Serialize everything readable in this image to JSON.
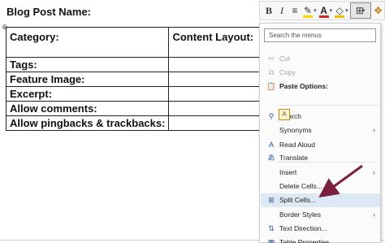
{
  "document": {
    "title": "Blog Post Name:",
    "table_rows": [
      [
        "Category:",
        "Content Layout:",
        ""
      ],
      [
        "Tags:",
        "",
        ""
      ],
      [
        "Feature Image:",
        "",
        ""
      ],
      [
        "Excerpt:",
        "",
        ""
      ],
      [
        "Allow comments:",
        "",
        ""
      ],
      [
        "Allow pingbacks & trackbacks:",
        "",
        ""
      ]
    ],
    "move_handle_glyph": "⊕"
  },
  "toolbar": {
    "bold_glyph": "B",
    "italic_glyph": "I",
    "underline_glyph": "≡",
    "highlight_glyph": "✎",
    "fontcolor_glyph": "A",
    "shading_glyph": "◇",
    "borders_glyph": "⊞",
    "drop_glyph": "▾",
    "paint_glyph": "✥",
    "icons": [
      "bold-icon",
      "italic-icon",
      "paragraph-icon",
      "highlight-icon",
      "font-color-icon",
      "shading-icon",
      "borders-icon",
      "format-painter-icon"
    ]
  },
  "context_menu": {
    "search_placeholder": "Search the menus",
    "items": [
      {
        "label": "Cut",
        "icon": "✂",
        "disabled": true
      },
      {
        "label": "Copy",
        "icon": "⧉",
        "disabled": true
      },
      {
        "label": "Paste Options:",
        "icon": "📋",
        "bold": true
      },
      {
        "label": "Search",
        "icon": "⚲"
      },
      {
        "label": "Synonyms",
        "icon": "",
        "submenu": true
      },
      {
        "label": "Read Aloud",
        "icon": "A"
      },
      {
        "label": "Translate",
        "icon": "あ"
      },
      {
        "label": "Insert",
        "icon": "",
        "submenu": true
      },
      {
        "label": "Delete Cells...",
        "icon": ""
      },
      {
        "label": "Split Cells...",
        "icon": "⊞",
        "highlighted": true
      },
      {
        "label": "Border Styles",
        "icon": "",
        "submenu": true
      },
      {
        "label": "Text Direction...",
        "icon": "⇅"
      },
      {
        "label": "Table Properties...",
        "icon": "▦"
      }
    ],
    "paste_option_glyph": "A",
    "submenu_arrow": "›"
  },
  "colors": {
    "arrow": "#7a1f3d",
    "highlight_row": "#dde8f5",
    "icon_blue": "#2b579a"
  }
}
